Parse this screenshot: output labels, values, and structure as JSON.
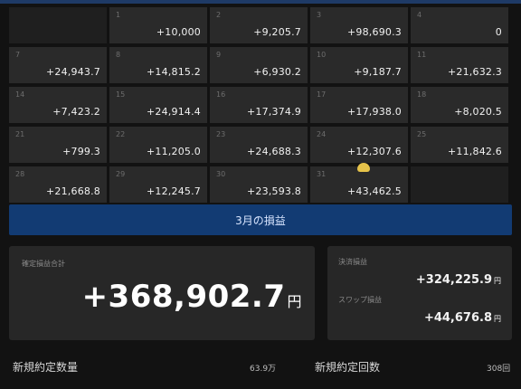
{
  "calendar": {
    "rows": [
      [
        {
          "day": "",
          "value": ""
        },
        {
          "day": "1",
          "value": "+10,000"
        },
        {
          "day": "2",
          "value": "+9,205.7"
        },
        {
          "day": "3",
          "value": "+98,690.3"
        },
        {
          "day": "4",
          "value": "0"
        }
      ],
      [
        {
          "day": "7",
          "value": "+24,943.7"
        },
        {
          "day": "8",
          "value": "+14,815.2"
        },
        {
          "day": "9",
          "value": "+6,930.2"
        },
        {
          "day": "10",
          "value": "+9,187.7"
        },
        {
          "day": "11",
          "value": "+21,632.3"
        }
      ],
      [
        {
          "day": "14",
          "value": "+7,423.2"
        },
        {
          "day": "15",
          "value": "+24,914.4"
        },
        {
          "day": "16",
          "value": "+17,374.9"
        },
        {
          "day": "17",
          "value": "+17,938.0"
        },
        {
          "day": "18",
          "value": "+8,020.5"
        }
      ],
      [
        {
          "day": "21",
          "value": "+799.3"
        },
        {
          "day": "22",
          "value": "+11,205.0"
        },
        {
          "day": "23",
          "value": "+24,688.3"
        },
        {
          "day": "24",
          "value": "+12,307.6"
        },
        {
          "day": "25",
          "value": "+11,842.6"
        }
      ],
      [
        {
          "day": "28",
          "value": "+21,668.8"
        },
        {
          "day": "29",
          "value": "+12,245.7"
        },
        {
          "day": "30",
          "value": "+23,593.8"
        },
        {
          "day": "31",
          "value": "+43,462.5"
        },
        {
          "day": "",
          "value": ""
        }
      ]
    ]
  },
  "month_bar": {
    "label": "3月の損益"
  },
  "total": {
    "label": "確定損益合計",
    "amount": "+368,902.7",
    "unit": "円"
  },
  "breakdown": {
    "label1": "決済損益",
    "value1": "+324,225.9",
    "label2": "スワップ損益",
    "value2": "+44,676.8",
    "unit": "円"
  },
  "footer": {
    "label1": "新規約定数量",
    "value1": "63.9万",
    "label2": "新規約定回数",
    "value2": "308回"
  },
  "colors": {
    "background": "#121212",
    "cell": "#2a2a2a",
    "month_bar": "#123b73",
    "badge": "#e6c34a"
  }
}
